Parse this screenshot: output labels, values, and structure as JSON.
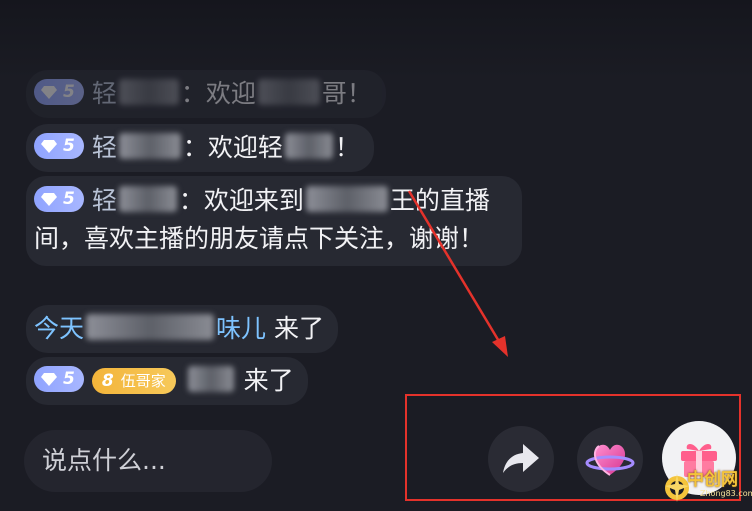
{
  "messages": [
    {
      "level": "5",
      "user": "轻",
      "text": "：欢迎",
      "tail": "哥！"
    },
    {
      "level": "5",
      "user": "轻",
      "text": "：欢迎轻",
      "tail": "！"
    },
    {
      "level": "5",
      "user": "轻",
      "text": "：欢迎来到",
      "tail_line": "王的直播间，喜欢主播的朋友请点下关注，谢谢！"
    },
    {
      "prefix": "今天",
      "name_tail": "味儿",
      "action": "来了"
    },
    {
      "level": "5",
      "fan_level": "8",
      "fan_name": "伍哥家",
      "action": "来了"
    }
  ],
  "input": {
    "placeholder": "说点什么..."
  },
  "colors": {
    "annotation": "#e4322b",
    "badge": "#8fa3ff",
    "fan_badge": "#f3b43a",
    "highlight": "#7ec3ff"
  },
  "icons": {
    "share": "share-icon",
    "like": "heart-planet-icon",
    "gift": "gift-icon"
  },
  "watermark": {
    "text": "中创网",
    "sub": "Zhong83.com"
  }
}
